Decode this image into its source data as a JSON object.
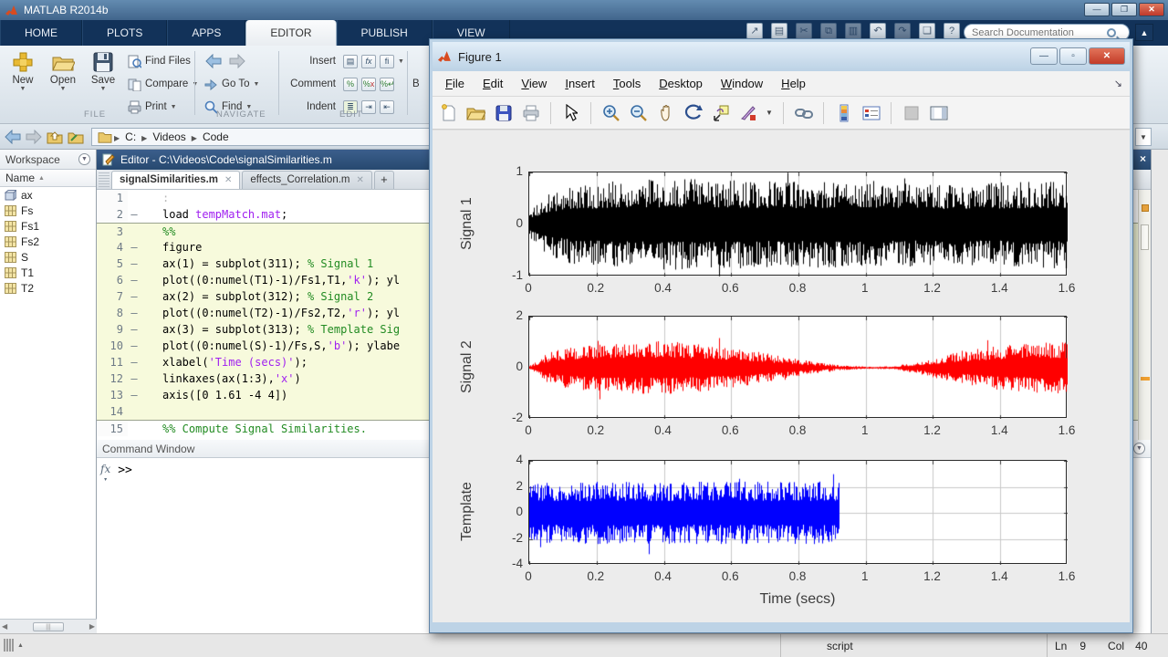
{
  "window": {
    "title": "MATLAB R2014b",
    "buttons": {
      "minimize": "—",
      "maximize": "❐",
      "close": "✕"
    }
  },
  "toolstrip": {
    "tabs": [
      {
        "label": "HOME",
        "active": false
      },
      {
        "label": "PLOTS",
        "active": false
      },
      {
        "label": "APPS",
        "active": false
      },
      {
        "label": "EDITOR",
        "active": true
      },
      {
        "label": "PUBLISH",
        "active": false
      },
      {
        "label": "VIEW",
        "active": false
      }
    ],
    "file_section": {
      "label": "FILE",
      "new": "New",
      "open": "Open",
      "save": "Save",
      "find_files": "Find Files",
      "compare": "Compare",
      "print": "Print"
    },
    "navigate_section": {
      "label": "NAVIGATE",
      "goto": "Go To",
      "find": "Find"
    },
    "edit_section": {
      "label": "EDIT",
      "insert": "Insert",
      "comment": "Comment",
      "indent": "Indent"
    },
    "breakpoints_partial_label": "B",
    "search_placeholder": "Search Documentation"
  },
  "address_bar": {
    "path": [
      "C:",
      "Videos",
      "Code"
    ]
  },
  "workspace": {
    "title": "Workspace",
    "column_header": "Name",
    "variables": [
      {
        "name": "ax",
        "icon": "handle-array-icon"
      },
      {
        "name": "Fs",
        "icon": "matrix-icon"
      },
      {
        "name": "Fs1",
        "icon": "matrix-icon"
      },
      {
        "name": "Fs2",
        "icon": "matrix-icon"
      },
      {
        "name": "S",
        "icon": "matrix-icon"
      },
      {
        "name": "T1",
        "icon": "matrix-icon"
      },
      {
        "name": "T2",
        "icon": "matrix-icon"
      }
    ]
  },
  "editor": {
    "title": "Editor - C:\\Videos\\Code\\signalSimilarities.m",
    "tabs": [
      {
        "label": "signalSimilarities.m",
        "active": true
      },
      {
        "label": "effects_Correlation.m",
        "active": false
      }
    ],
    "new_tab_button": "+",
    "lines": [
      {
        "n": "1",
        "dash": false,
        "hl": false,
        "sec": false,
        "tokens": [
          [
            "f",
            ":"
          ]
        ]
      },
      {
        "n": "2",
        "dash": true,
        "hl": false,
        "sec": false,
        "tokens": [
          [
            "p",
            "load "
          ],
          [
            "s",
            "tempMatch.mat"
          ],
          [
            "p",
            ";"
          ]
        ]
      },
      {
        "n": "3",
        "dash": false,
        "hl": true,
        "sec": true,
        "tokens": [
          [
            "c",
            "%%"
          ]
        ]
      },
      {
        "n": "4",
        "dash": true,
        "hl": true,
        "sec": false,
        "tokens": [
          [
            "p",
            "figure"
          ]
        ]
      },
      {
        "n": "5",
        "dash": true,
        "hl": true,
        "sec": false,
        "tokens": [
          [
            "p",
            "ax(1) = subplot(311); "
          ],
          [
            "c",
            "% Signal 1"
          ]
        ]
      },
      {
        "n": "6",
        "dash": true,
        "hl": true,
        "sec": false,
        "tokens": [
          [
            "p",
            "plot((0:numel(T1)-1)/Fs1,T1,"
          ],
          [
            "s",
            "'k'"
          ],
          [
            "p",
            "); yl"
          ]
        ]
      },
      {
        "n": "7",
        "dash": true,
        "hl": true,
        "sec": false,
        "tokens": [
          [
            "p",
            "ax(2) = subplot(312); "
          ],
          [
            "c",
            "% Signal 2"
          ]
        ]
      },
      {
        "n": "8",
        "dash": true,
        "hl": true,
        "sec": false,
        "tokens": [
          [
            "p",
            "plot((0:numel(T2)-1)/Fs2,T2,"
          ],
          [
            "s",
            "'r'"
          ],
          [
            "p",
            "); yl"
          ]
        ]
      },
      {
        "n": "9",
        "dash": true,
        "hl": true,
        "sec": false,
        "tokens": [
          [
            "p",
            "ax(3) = subplot(313); "
          ],
          [
            "c",
            "% Template Sig"
          ]
        ]
      },
      {
        "n": "10",
        "dash": true,
        "hl": true,
        "sec": false,
        "tokens": [
          [
            "p",
            "plot((0:numel(S)-1)/Fs,S,"
          ],
          [
            "s",
            "'b'"
          ],
          [
            "p",
            "); ylabe"
          ]
        ]
      },
      {
        "n": "11",
        "dash": true,
        "hl": true,
        "sec": false,
        "tokens": [
          [
            "p",
            "xlabel("
          ],
          [
            "s",
            "'Time (secs)'"
          ],
          [
            "p",
            ");"
          ]
        ]
      },
      {
        "n": "12",
        "dash": true,
        "hl": true,
        "sec": false,
        "tokens": [
          [
            "p",
            "linkaxes(ax(1:3),"
          ],
          [
            "s",
            "'x'"
          ],
          [
            "p",
            ")"
          ]
        ]
      },
      {
        "n": "13",
        "dash": true,
        "hl": true,
        "sec": false,
        "tokens": [
          [
            "p",
            "axis([0 1.61 -4 4])"
          ]
        ]
      },
      {
        "n": "14",
        "dash": false,
        "hl": true,
        "sec": false,
        "tokens": []
      },
      {
        "n": "15",
        "dash": false,
        "hl": false,
        "sec": true,
        "tokens": [
          [
            "c",
            "%% Compute Signal Similarities."
          ]
        ]
      }
    ]
  },
  "command_window": {
    "title": "Command Window",
    "prompt": ">>"
  },
  "status_bar": {
    "mode": "script",
    "line_label": "Ln",
    "line": "9",
    "col_label": "Col",
    "col": "40"
  },
  "figure_window": {
    "title": "Figure 1",
    "buttons": {
      "minimize": "—",
      "restore": "▫",
      "close": "✕"
    },
    "menus": [
      "File",
      "Edit",
      "View",
      "Insert",
      "Tools",
      "Desktop",
      "Window",
      "Help"
    ],
    "toolbar_icons": [
      "new-figure",
      "open-file",
      "save-figure",
      "print-figure",
      "edit-plot-pointer",
      "zoom-in",
      "zoom-out",
      "pan",
      "rotate-3d",
      "data-cursor",
      "brush",
      "link-plot",
      "insert-colorbar",
      "insert-legend",
      "hide-plot-tools",
      "show-plot-tools"
    ],
    "xlabel": "Time (secs)",
    "chart_data": [
      {
        "type": "line",
        "ylabel": "Signal 1",
        "line_color": "#000000",
        "description": "dense zero-mean random noise over full time axis, amplitude about ±0.85 with spikes clipping at ±1",
        "xlim": [
          0,
          1.6
        ],
        "ylim": [
          -1,
          1
        ],
        "xticks": [
          0,
          0.2,
          0.4,
          0.6,
          0.8,
          1,
          1.2,
          1.4,
          1.6
        ],
        "xtick_labels": [
          "0",
          "0.2",
          "0.4",
          "0.6",
          "0.8",
          "1",
          "1.2",
          "1.4",
          "1.6"
        ],
        "yticks": [
          -1,
          0,
          1
        ],
        "grid": true,
        "signal_end": 1.6,
        "seed": 11,
        "envelope": [
          [
            0,
            0.28
          ],
          [
            0.04,
            0.55
          ],
          [
            0.12,
            0.75
          ],
          [
            0.25,
            0.85
          ],
          [
            0.5,
            0.88
          ],
          [
            0.75,
            0.82
          ],
          [
            1.0,
            0.85
          ],
          [
            1.25,
            0.78
          ],
          [
            1.45,
            0.82
          ],
          [
            1.6,
            0.85
          ]
        ]
      },
      {
        "type": "line",
        "ylabel": "Signal 2",
        "line_color": "#ff0000",
        "description": "amplitude-modulated noise: grows to ~±1 by t=0.25, pinches to near zero around t=0.95–1.1, grows back to ~±1 by t=1.4",
        "xlim": [
          0,
          1.6
        ],
        "ylim": [
          -2,
          2
        ],
        "xticks": [
          0,
          0.2,
          0.4,
          0.6,
          0.8,
          1,
          1.2,
          1.4,
          1.6
        ],
        "xtick_labels": [
          "0",
          "0.2",
          "0.4",
          "0.6",
          "0.8",
          "1",
          "1.2",
          "1.4",
          "1.6"
        ],
        "yticks": [
          -2,
          0,
          2
        ],
        "grid": true,
        "signal_end": 1.6,
        "seed": 22,
        "envelope": [
          [
            0,
            0.08
          ],
          [
            0.05,
            0.55
          ],
          [
            0.12,
            0.85
          ],
          [
            0.25,
            1.0
          ],
          [
            0.42,
            1.05
          ],
          [
            0.55,
            0.9
          ],
          [
            0.65,
            0.7
          ],
          [
            0.75,
            0.45
          ],
          [
            0.85,
            0.22
          ],
          [
            0.92,
            0.1
          ],
          [
            1.0,
            0.045
          ],
          [
            1.08,
            0.06
          ],
          [
            1.15,
            0.22
          ],
          [
            1.25,
            0.55
          ],
          [
            1.38,
            0.85
          ],
          [
            1.5,
            1.0
          ],
          [
            1.6,
            1.0
          ]
        ]
      },
      {
        "type": "line",
        "ylabel": "Template",
        "line_color": "#0000ff",
        "description": "dense zero-mean noise of amplitude about ±2.5 with spikes to ±3.8, present only from t=0 to t≈0.92, nothing after",
        "xlim": [
          0,
          1.6
        ],
        "ylim": [
          -4,
          4
        ],
        "xticks": [
          0,
          0.2,
          0.4,
          0.6,
          0.8,
          1,
          1.2,
          1.4,
          1.6
        ],
        "xtick_labels": [
          "0",
          "0.2",
          "0.4",
          "0.6",
          "0.8",
          "1",
          "1.2",
          "1.4",
          "1.6"
        ],
        "yticks": [
          -4,
          -2,
          0,
          2,
          4
        ],
        "grid": true,
        "signal_end": 0.92,
        "seed": 33,
        "envelope": [
          [
            0,
            2.4
          ],
          [
            0.92,
            2.4
          ]
        ]
      }
    ]
  }
}
